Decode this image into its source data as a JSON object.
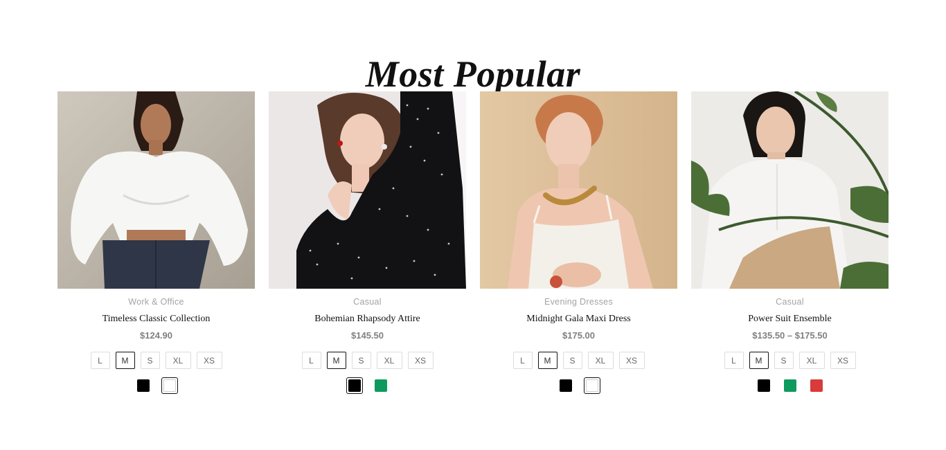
{
  "section": {
    "title": "Most Popular"
  },
  "products": [
    {
      "category": "Work & Office",
      "name": "Timeless Classic Collection",
      "price": "$124.90",
      "image_alt": "Woman in white off-shoulder blouse and dark jeans",
      "sizes": [
        "L",
        "M",
        "S",
        "XL",
        "XS"
      ],
      "selected_size": "M",
      "colors": [
        {
          "name": "black",
          "hex": "#000000"
        },
        {
          "name": "white",
          "hex": "#ffffff"
        }
      ],
      "selected_color": "white"
    },
    {
      "category": "Casual",
      "name": "Bohemian Rhapsody Attire",
      "price": "$145.50",
      "image_alt": "Woman in black polka-dot dress",
      "sizes": [
        "L",
        "M",
        "S",
        "XL",
        "XS"
      ],
      "selected_size": "M",
      "colors": [
        {
          "name": "black",
          "hex": "#000000"
        },
        {
          "name": "green",
          "hex": "#0e9a5f"
        }
      ],
      "selected_color": "black"
    },
    {
      "category": "Evening Dresses",
      "name": "Midnight Gala Maxi Dress",
      "price": "$175.00",
      "image_alt": "Woman in white slip top with gold necklace",
      "sizes": [
        "L",
        "M",
        "S",
        "XL",
        "XS"
      ],
      "selected_size": "M",
      "colors": [
        {
          "name": "black",
          "hex": "#000000"
        },
        {
          "name": "white",
          "hex": "#ffffff"
        }
      ],
      "selected_color": "white"
    },
    {
      "category": "Casual",
      "name": "Power Suit Ensemble",
      "price": "$135.50 – $175.50",
      "image_alt": "Woman in white cardigan and beige trousers with plant",
      "sizes": [
        "L",
        "M",
        "S",
        "XL",
        "XS"
      ],
      "selected_size": "M",
      "colors": [
        {
          "name": "black",
          "hex": "#000000"
        },
        {
          "name": "green",
          "hex": "#0e9a5f"
        },
        {
          "name": "red",
          "hex": "#d93a3a"
        }
      ],
      "selected_color": ""
    }
  ]
}
